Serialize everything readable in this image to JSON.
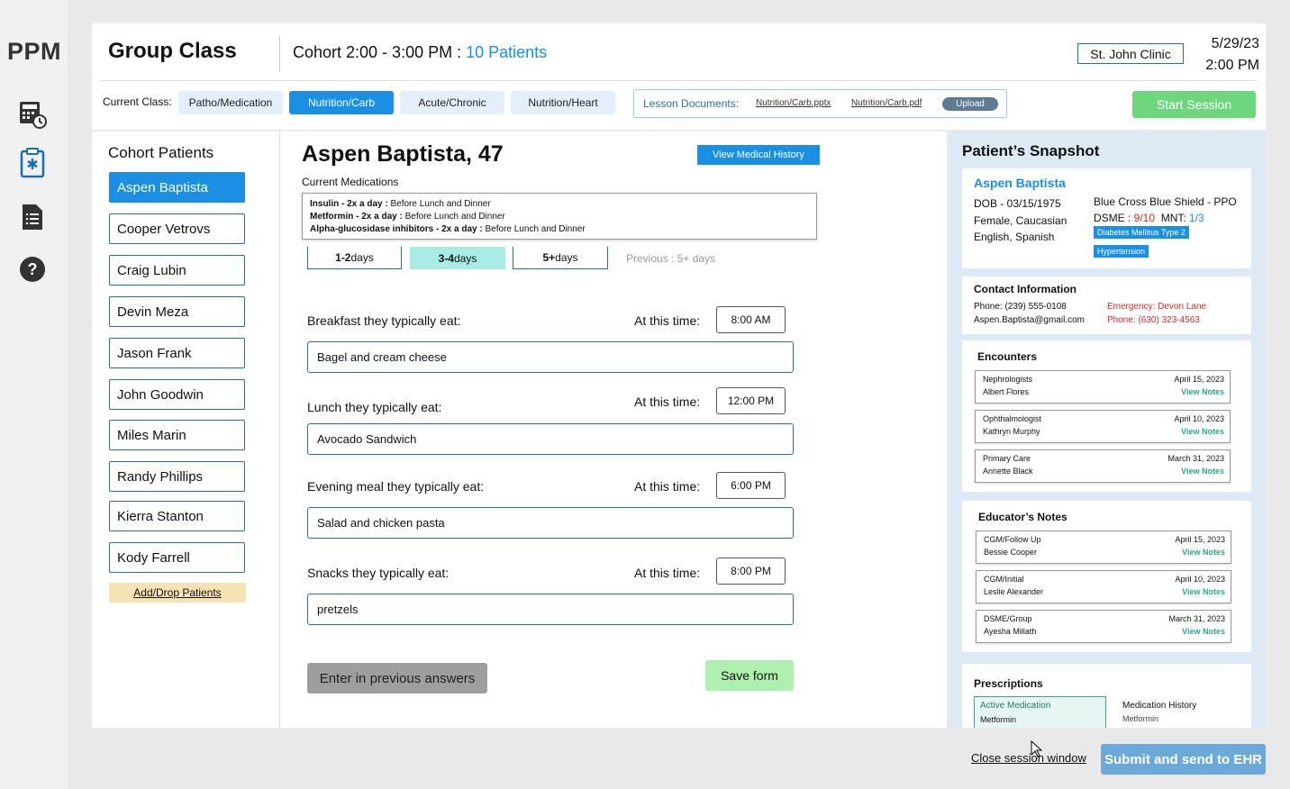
{
  "app": {
    "logo": "PPM"
  },
  "rail": {
    "icons": [
      "calculator-clock-icon",
      "clipboard-icon",
      "document-list-icon",
      "help-icon"
    ]
  },
  "header": {
    "title": "Group Class",
    "cohort_prefix": "Cohort 2:00 - 3:00 PM : ",
    "patients_count": "10 Patients",
    "clinic": "St. John Clinic",
    "date": "5/29/23",
    "time": "2:00 PM"
  },
  "classbar": {
    "current_label": "Current Class:",
    "tabs": [
      "Patho/Medication",
      "Nutrition/Carb",
      "Acute/Chronic",
      "Nutrition/Heart"
    ],
    "active_tab": "Nutrition/Carb",
    "docs_label": "Lesson Documents:",
    "files": [
      "Nutrition/Carb.pptx",
      "Nutrition/Carb.pdf"
    ],
    "upload": "Upload",
    "start": "Start Session"
  },
  "cohort": {
    "heading": "Cohort Patients",
    "patients": [
      "Aspen Baptista",
      "Cooper Vetrovs",
      "Craig Lubin",
      "Devin Meza",
      "Jason Frank",
      "John Goodwin",
      "Miles Marin",
      "Randy Phillips",
      "Kierra Stanton",
      "Kody Farrell"
    ],
    "add_drop": "Add/Drop Patients"
  },
  "patient": {
    "name": "Aspen Baptista, 47",
    "view_history": "View Medical History",
    "meds_label": "Current Medications",
    "meds": [
      {
        "name": "Insulin - 2x a day :",
        "note": " Before Lunch and Dinner"
      },
      {
        "name": "Metformin - 2x a day :",
        "note": " Before Lunch and Dinner"
      },
      {
        "name": "Alpha-glucosidase inhibitors - 2x a day :",
        "note": " Before Lunch and Dinner"
      }
    ],
    "days": [
      {
        "bold": "1-2",
        "rest": " days"
      },
      {
        "bold": "3-4",
        "rest": " days"
      },
      {
        "bold": "5+",
        "rest": " days"
      }
    ],
    "days_selected": "3-4",
    "previous": "Previous : 5+ days"
  },
  "form": {
    "at_time_label": "At this time:",
    "questions": [
      {
        "label": "Breakfast they typically eat:",
        "time": "8:00 AM",
        "answer": "Bagel and cream cheese"
      },
      {
        "label": "Lunch they typically eat:",
        "time": "12:00 PM",
        "answer": "Avocado Sandwich"
      },
      {
        "label": "Evening meal they typically eat:",
        "time": "6:00 PM",
        "answer": "Salad and chicken pasta"
      },
      {
        "label": "Snacks they typically eat:",
        "time": "8:00 PM",
        "answer": "pretzels"
      }
    ],
    "prev_answers": "Enter in previous answers",
    "save": "Save form"
  },
  "snapshot": {
    "heading": "Patient’s Snapshot",
    "name": "Aspen Baptista",
    "dob": "DOB - 03/15/1975",
    "demo": "Female, Caucasian",
    "lang": "English, Spanish",
    "insurance": "Blue Cross Blue Shield - PPO",
    "dsme_label": "DSME : ",
    "dsme_val": "9/10",
    "mnt_label": "MNT: ",
    "mnt_val": "1/3",
    "tags": [
      "Diabetes Mellitus Type 2",
      "Hypertension"
    ],
    "contact": {
      "heading": "Contact Information",
      "phone": "Phone: (239) 555-0108",
      "email": "Aspen.Baptista@gmail.com",
      "emergency": "Emergency: Devon Lane",
      "emergency_phone": "Phone: (630) 323-4563"
    },
    "encounters_heading": "Encounters",
    "encounters": [
      {
        "type": "Nephrologists",
        "who": "Albert Flores",
        "date": "April 15, 2023",
        "link": "View Notes"
      },
      {
        "type": "Ophthalmologist",
        "who": "Kathryn Murphy",
        "date": "April 10, 2023",
        "link": "View Notes"
      },
      {
        "type": "Primary Care",
        "who": "Annette Black",
        "date": "March 31, 2023",
        "link": "View Notes"
      }
    ],
    "notes_heading": "Educator’s Notes",
    "notes": [
      {
        "type": "CGM/Follow Up",
        "who": "Bessie Cooper",
        "date": "April 15, 2023",
        "link": "View Notes"
      },
      {
        "type": "CGM/Initial",
        "who": "Leslie Alexander",
        "date": "April 10, 2023",
        "link": "View Notes"
      },
      {
        "type": "DSME/Group",
        "who": "Ayesha Millath",
        "date": "March 31, 2023",
        "link": "View Notes"
      }
    ],
    "rx_heading": "Prescriptions",
    "rx_active": "Active Medication",
    "rx_active_item": "Metformin",
    "rx_history": "Medication History",
    "rx_history_item": "Metformin"
  },
  "footer": {
    "close": "Close session window",
    "submit": "Submit and send to EHR"
  }
}
